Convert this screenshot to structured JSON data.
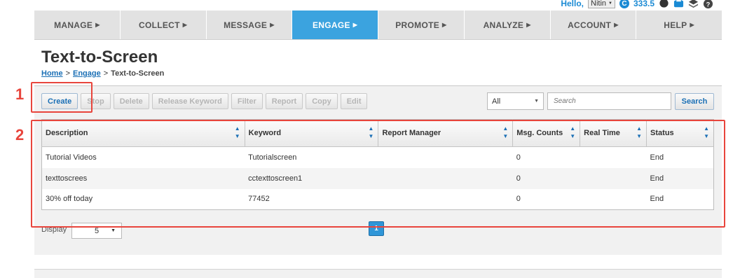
{
  "user": {
    "greeting": "Hello,",
    "name": "Nitin",
    "credits": "333.5",
    "credit_icon": "C"
  },
  "nav": {
    "items": [
      {
        "label": "MANAGE",
        "active": false
      },
      {
        "label": "COLLECT",
        "active": false
      },
      {
        "label": "MESSAGE",
        "active": false
      },
      {
        "label": "ENGAGE",
        "active": true
      },
      {
        "label": "PROMOTE",
        "active": false
      },
      {
        "label": "ANALYZE",
        "active": false
      },
      {
        "label": "ACCOUNT",
        "active": false
      },
      {
        "label": "HELP",
        "active": false
      }
    ],
    "arrow": "▶"
  },
  "page": {
    "title": "Text-to-Screen"
  },
  "breadcrumb": {
    "home": "Home",
    "sep": ">",
    "engage": "Engage",
    "current": "Text-to-Screen"
  },
  "toolbar": {
    "create": "Create",
    "stop": "Stop",
    "delete": "Delete",
    "release_keyword": "Release Keyword",
    "filter": "Filter",
    "report": "Report",
    "copy": "Copy",
    "edit": "Edit"
  },
  "filter": {
    "selected": "All"
  },
  "search": {
    "placeholder": "Search",
    "button": "Search"
  },
  "table": {
    "columns": [
      "Description",
      "Keyword",
      "Report Manager",
      "Msg. Counts",
      "Real Time",
      "Status"
    ],
    "rows": [
      [
        "Tutorial Videos",
        "Tutorialscreen",
        "",
        "0",
        "",
        "End"
      ],
      [
        "texttoscrees",
        "cctexttoscreen1",
        "",
        "0",
        "",
        "End"
      ],
      [
        "30% off today",
        "77452",
        "",
        "0",
        "",
        "End"
      ]
    ]
  },
  "pagination": {
    "display_label": "Display",
    "page_size": "5",
    "current_page": "1"
  },
  "annotations": {
    "one": "1",
    "two": "2",
    "color": "#e8453c"
  },
  "colors": {
    "accent": "#3ba3df",
    "link": "#1a6fb5"
  }
}
